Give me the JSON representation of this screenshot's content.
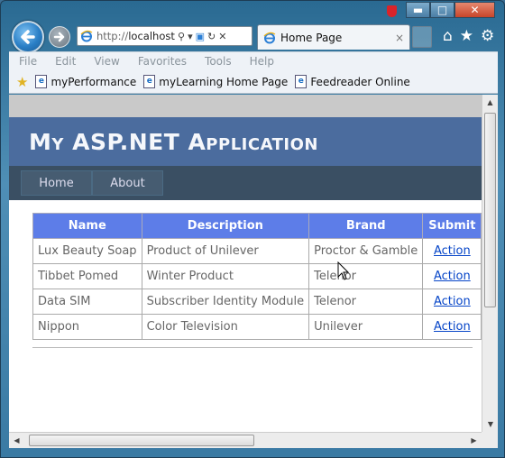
{
  "browser": {
    "address_prefix": "http://",
    "address_host": "localhost",
    "tab_title": "Home Page",
    "tab_close": "×",
    "menu": [
      "File",
      "Edit",
      "View",
      "Favorites",
      "Tools",
      "Help"
    ],
    "favorites": [
      "myPerformance",
      "myLearning Home Page",
      "Feedreader Online"
    ],
    "window_controls": {
      "minimize": "▬",
      "maximize": "□",
      "close": "✕"
    }
  },
  "page": {
    "title": "My ASP.NET Application",
    "nav": [
      "Home",
      "About"
    ],
    "table": {
      "headers": [
        "Name",
        "Description",
        "Brand",
        "Submit"
      ],
      "rows": [
        {
          "name": "Lux Beauty Soap",
          "description": "Product of Unilever",
          "brand": "Proctor & Gamble",
          "submit": "Action"
        },
        {
          "name": "Tibbet Pomed",
          "description": "Winter Product",
          "brand": "Telenor",
          "submit": "Action"
        },
        {
          "name": "Data SIM",
          "description": "Subscriber Identity Module",
          "brand": "Telenor",
          "submit": "Action"
        },
        {
          "name": "Nippon",
          "description": "Color Television",
          "brand": "Unilever",
          "submit": "Action"
        }
      ]
    }
  },
  "colors": {
    "header_bg": "#4b6c9e",
    "menu_bg": "#3a4f63",
    "table_header_bg": "#5d7de8",
    "link": "#0645c8"
  }
}
